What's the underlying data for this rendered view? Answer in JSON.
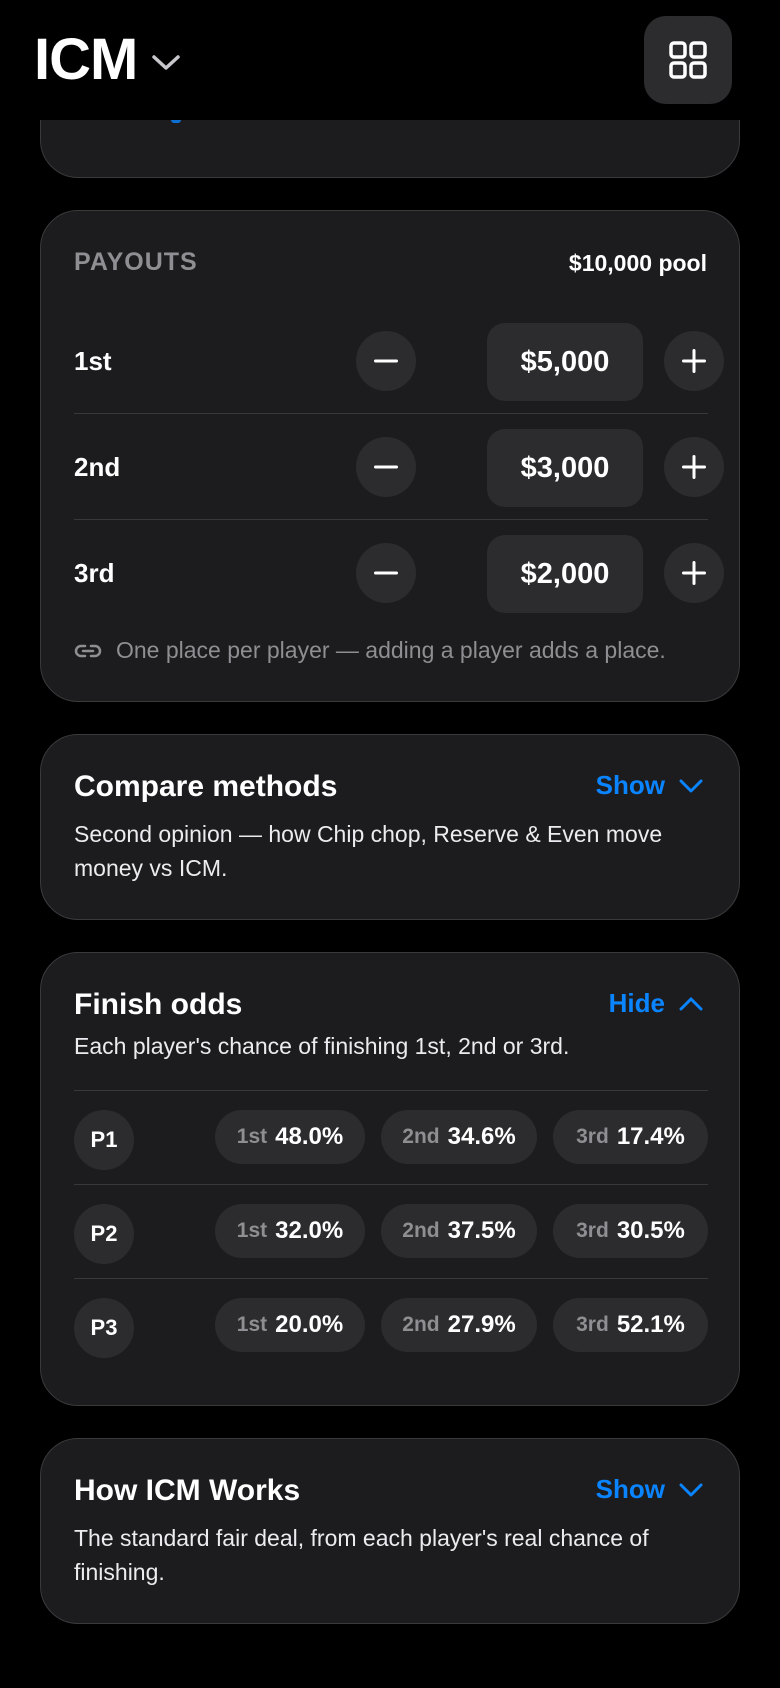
{
  "header": {
    "title": "ICM"
  },
  "payouts": {
    "label": "PAYOUTS",
    "pool": "$10,000 pool",
    "rows": [
      {
        "place": "1st",
        "amount": "$5,000"
      },
      {
        "place": "2nd",
        "amount": "$3,000"
      },
      {
        "place": "3rd",
        "amount": "$2,000"
      }
    ],
    "note": "One place per player — adding a player adds a place."
  },
  "compare": {
    "title": "Compare methods",
    "toggle": "Show",
    "description": "Second opinion — how Chip chop, Reserve & Even move money vs ICM."
  },
  "finish_odds": {
    "title": "Finish odds",
    "toggle": "Hide",
    "description": "Each player's chance of finishing 1st, 2nd or 3rd.",
    "players": [
      {
        "name": "P1",
        "odds": [
          {
            "label": "1st",
            "value": "48.0%"
          },
          {
            "label": "2nd",
            "value": "34.6%"
          },
          {
            "label": "3rd",
            "value": "17.4%"
          }
        ]
      },
      {
        "name": "P2",
        "odds": [
          {
            "label": "1st",
            "value": "32.0%"
          },
          {
            "label": "2nd",
            "value": "37.5%"
          },
          {
            "label": "3rd",
            "value": "30.5%"
          }
        ]
      },
      {
        "name": "P3",
        "odds": [
          {
            "label": "1st",
            "value": "20.0%"
          },
          {
            "label": "2nd",
            "value": "27.9%"
          },
          {
            "label": "3rd",
            "value": "52.1%"
          }
        ]
      }
    ]
  },
  "how_icm": {
    "title": "How ICM Works",
    "toggle": "Show",
    "description": "The standard fair deal, from each player's real chance of finishing."
  },
  "colors": {
    "accent": "#0a84ff",
    "card_bg": "#1c1c1e",
    "control_bg": "#2c2c2e",
    "muted_text": "#8e8e93"
  }
}
